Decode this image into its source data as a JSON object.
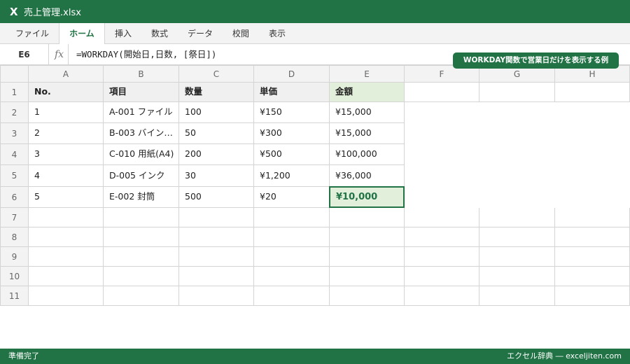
{
  "window": {
    "logo": "X",
    "title": "売上管理.xlsx"
  },
  "ribbon": {
    "tabs": [
      "ファイル",
      "ホーム",
      "挿入",
      "数式",
      "データ",
      "校閲",
      "表示"
    ],
    "active_tab": "ホーム"
  },
  "formula_bar": {
    "name_box": "E6",
    "fx_label": "fx",
    "formula": "=WORKDAY(開始日,日数, [祭日])"
  },
  "badge": {
    "text": "WORKDAY関数で営業日だけを表示する例"
  },
  "sheet": {
    "columns": [
      "A",
      "B",
      "C",
      "D",
      "E",
      "F",
      "G",
      "H"
    ],
    "rows": [
      "1",
      "2",
      "3",
      "4",
      "5",
      "6",
      "7",
      "8",
      "9",
      "10",
      "11"
    ],
    "headers": [
      "No.",
      "項目",
      "数量",
      "単価",
      "金額"
    ],
    "data": [
      [
        "1",
        "A-001 ファイル",
        "100",
        "¥150",
        "¥15,000"
      ],
      [
        "2",
        "B-003 バイン…",
        "50",
        "¥300",
        "¥15,000"
      ],
      [
        "3",
        "C-010 用紙(A4)",
        "200",
        "¥500",
        "¥100,000"
      ],
      [
        "4",
        "D-005 インク",
        "30",
        "¥1,200",
        "¥36,000"
      ],
      [
        "5",
        "E-002 封筒",
        "500",
        "¥20",
        "¥10,000"
      ]
    ],
    "selected_cell": "E6"
  },
  "status": {
    "left": "準備完了",
    "right": "エクセル辞典 ― exceljiten.com"
  },
  "colors": {
    "accent": "#217346",
    "header_fill": "#e2efda",
    "grid_line": "#d4d4d4"
  }
}
